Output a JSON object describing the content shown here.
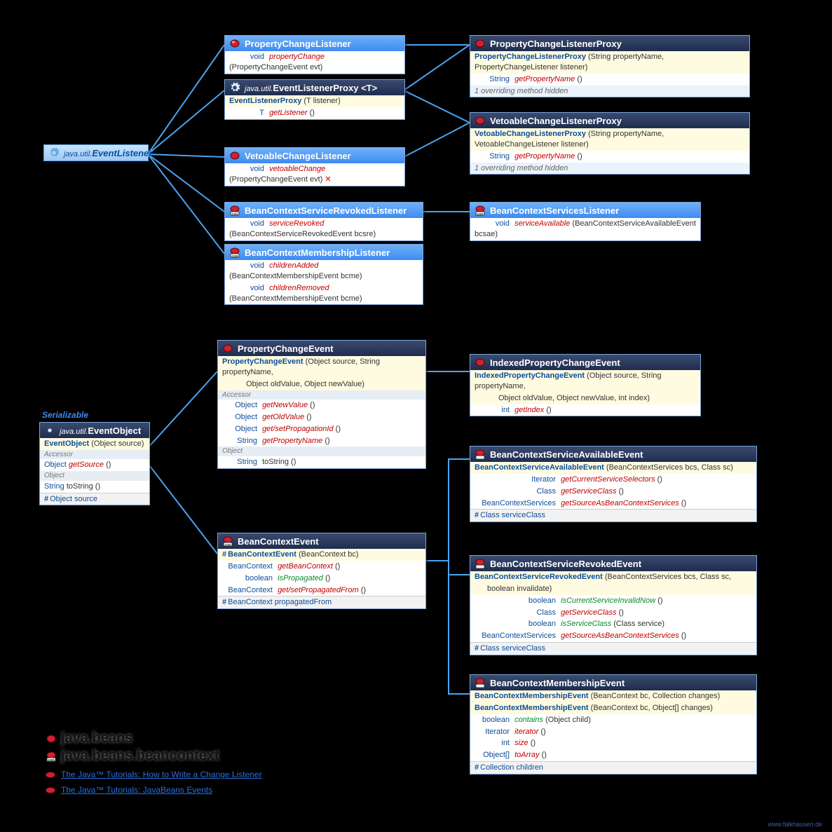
{
  "root": {
    "pkg": "java.util.",
    "name": "EventListener"
  },
  "serial": "Serializable",
  "watermark": "www.falkhausen.de",
  "pkg1": "java.beans",
  "pkg2": "java.beans.beancontext",
  "link1": "The Java™ Tutorials: How to Write a Change Listener",
  "link2": "The Java™ Tutorials: JavaBeans Events",
  "pcl": {
    "title": "PropertyChangeListener",
    "r1_t": "void",
    "r1_m": "propertyChange",
    "r1_p": "(PropertyChangeEvent evt)"
  },
  "elp": {
    "pkg": "java.util.",
    "title": "EventListenerProxy",
    "tparam": "<T>",
    "c_t": "EventListenerProxy",
    "c_p": "(T listener)",
    "r1_t": "T",
    "r1_m": "getListener",
    "r1_p": "()"
  },
  "vcl": {
    "title": "VetoableChangeListener",
    "r1_t": "void",
    "r1_m": "vetoableChange",
    "r1_p": "(PropertyChangeEvent evt)",
    "r1_x": "✕"
  },
  "bcsrl": {
    "title": "BeanContextServiceRevokedListener",
    "r1_t": "void",
    "r1_m": "serviceRevoked",
    "r1_p": "(BeanContextServiceRevokedEvent bcsre)"
  },
  "bcml": {
    "title": "BeanContextMembershipListener",
    "r1_t": "void",
    "r1_m": "childrenAdded",
    "r1_p": "(BeanContextMembershipEvent bcme)",
    "r2_t": "void",
    "r2_m": "childrenRemoved",
    "r2_p": "(BeanContextMembershipEvent bcme)"
  },
  "pclp": {
    "title": "PropertyChangeListenerProxy",
    "c_t": "PropertyChangeListenerProxy",
    "c_p": "(String propertyName, PropertyChangeListener listener)",
    "r1_t": "String",
    "r1_m": "getPropertyName",
    "r1_p": "()",
    "note": "1 overriding method hidden"
  },
  "vclp": {
    "title": "VetoableChangeListenerProxy",
    "c_t": "VetoableChangeListenerProxy",
    "c_p": "(String propertyName, VetoableChangeListener listener)",
    "r1_t": "String",
    "r1_m": "getPropertyName",
    "r1_p": "()",
    "note": "1 overriding method hidden"
  },
  "bcsl": {
    "title": "BeanContextServicesListener",
    "r1_t": "void",
    "r1_m": "serviceAvailable",
    "r1_p": "(BeanContextServiceAvailableEvent bcsae)"
  },
  "eo": {
    "pkg": "java.util.",
    "title": "EventObject",
    "c_t": "EventObject",
    "c_p": "(Object source)",
    "s1": "Accessor",
    "r1_t": "Object",
    "r1_m": "getSource",
    "r1_p": "()",
    "s2": "Object",
    "r2_t": "String",
    "r2_m": "toString",
    "r2_p": "()",
    "f1": "Object source"
  },
  "pce": {
    "title": "PropertyChangeEvent",
    "c_t": "PropertyChangeEvent",
    "c_p1": "(Object source, String propertyName,",
    "c_p2": "Object oldValue, Object newValue)",
    "s1": "Accessor",
    "r1_t": "Object",
    "r1_m": "getNewValue",
    "r1_p": "()",
    "r2_t": "Object",
    "r2_m": "getOldValue",
    "r2_p": "()",
    "r3_t": "Object",
    "r3_m": "get/setPropagationId",
    "r3_p": "()",
    "r4_t": "String",
    "r4_m": "getPropertyName",
    "r4_p": "()",
    "s2": "Object",
    "r5_t": "String",
    "r5_m": "toString",
    "r5_p": "()"
  },
  "ipce": {
    "title": "IndexedPropertyChangeEvent",
    "c_t": "IndexedPropertyChangeEvent",
    "c_p1": "(Object source, String propertyName,",
    "c_p2": "Object oldValue, Object newValue, int index)",
    "r1_t": "int",
    "r1_m": "getIndex",
    "r1_p": "()"
  },
  "bce": {
    "title": "BeanContextEvent",
    "c_t": "BeanContextEvent",
    "c_p": "(BeanContext bc)",
    "r1_t": "BeanContext",
    "r1_m": "getBeanContext",
    "r1_p": "()",
    "r2_t": "boolean",
    "r2_m": "isPropagated",
    "r2_p": "()",
    "r3_t": "BeanContext",
    "r3_m": "get/setPropagatedFrom",
    "r3_p": "()",
    "f1": "BeanContext propagatedFrom"
  },
  "bcsae": {
    "title": "BeanContextServiceAvailableEvent",
    "c_t": "BeanContextServiceAvailableEvent",
    "c_p": "(BeanContextServices bcs, Class sc)",
    "r1_t": "Iterator",
    "r1_m": "getCurrentServiceSelectors",
    "r1_p": "()",
    "r2_t": "Class",
    "r2_m": "getServiceClass",
    "r2_p": "()",
    "r3_t": "BeanContextServices",
    "r3_m": "getSourceAsBeanContextServices",
    "r3_p": "()",
    "f1": "Class serviceClass"
  },
  "bcsre": {
    "title": "BeanContextServiceRevokedEvent",
    "c_t": "BeanContextServiceRevokedEvent",
    "c_p1": "(BeanContextServices bcs, Class sc,",
    "c_p2": "boolean invalidate)",
    "r1_t": "boolean",
    "r1_m": "isCurrentServiceInvalidNow",
    "r1_p": "()",
    "r2_t": "Class",
    "r2_m": "getServiceClass",
    "r2_p": "()",
    "r3_t": "boolean",
    "r3_m": "isServiceClass",
    "r3_p": "(Class service)",
    "r4_t": "BeanContextServices",
    "r4_m": "getSourceAsBeanContextServices",
    "r4_p": "()",
    "f1": "Class serviceClass"
  },
  "bcme": {
    "title": "BeanContextMembershipEvent",
    "c1_t": "BeanContextMembershipEvent",
    "c1_p": "(BeanContext bc, Collection changes)",
    "c2_t": "BeanContextMembershipEvent",
    "c2_p": "(BeanContext bc, Object[] changes)",
    "r1_t": "boolean",
    "r1_m": "contains",
    "r1_p": "(Object child)",
    "r2_t": "Iterator",
    "r2_m": "iterator",
    "r2_p": "()",
    "r3_t": "int",
    "r3_m": "size",
    "r3_p": "()",
    "r4_t": "Object[]",
    "r4_m": "toArray",
    "r4_p": "()",
    "f1": "Collection children"
  }
}
